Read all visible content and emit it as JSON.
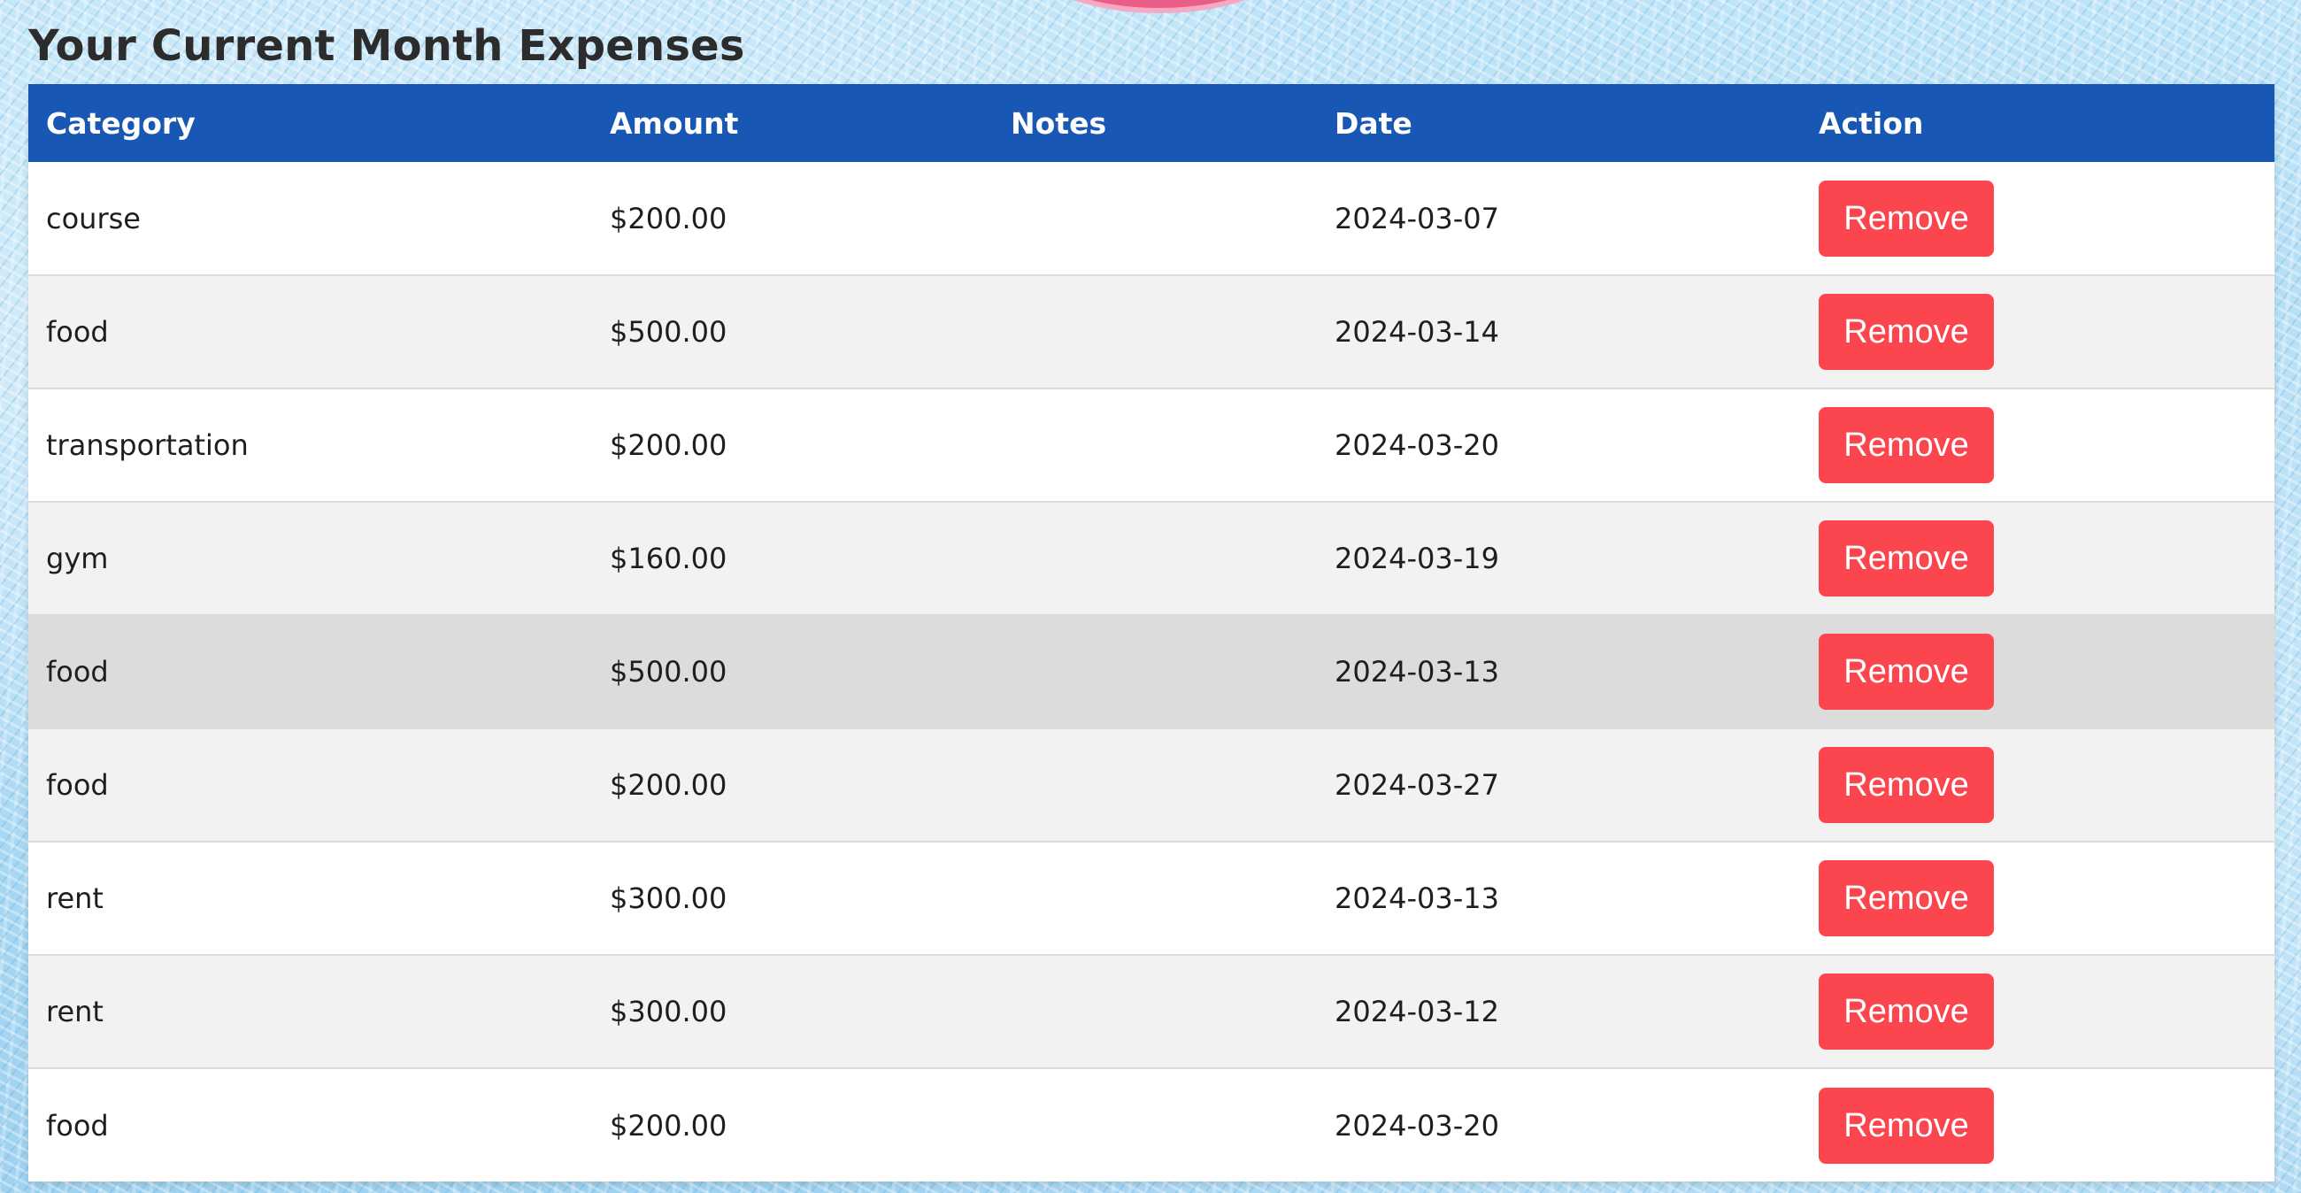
{
  "page": {
    "title": "Your Current Month Expenses"
  },
  "table": {
    "headers": {
      "category": "Category",
      "amount": "Amount",
      "notes": "Notes",
      "date": "Date",
      "action": "Action"
    },
    "rows": [
      {
        "category": "course",
        "amount": "$200.00",
        "notes": "",
        "date": "2024-03-07",
        "action": "Remove"
      },
      {
        "category": "food",
        "amount": "$500.00",
        "notes": "",
        "date": "2024-03-14",
        "action": "Remove"
      },
      {
        "category": "transportation",
        "amount": "$200.00",
        "notes": "",
        "date": "2024-03-20",
        "action": "Remove"
      },
      {
        "category": "gym",
        "amount": "$160.00",
        "notes": "",
        "date": "2024-03-19",
        "action": "Remove"
      },
      {
        "category": "food",
        "amount": "$500.00",
        "notes": "",
        "date": "2024-03-13",
        "action": "Remove"
      },
      {
        "category": "food",
        "amount": "$200.00",
        "notes": "",
        "date": "2024-03-27",
        "action": "Remove"
      },
      {
        "category": "rent",
        "amount": "$300.00",
        "notes": "",
        "date": "2024-03-13",
        "action": "Remove"
      },
      {
        "category": "rent",
        "amount": "$300.00",
        "notes": "",
        "date": "2024-03-12",
        "action": "Remove"
      },
      {
        "category": "food",
        "amount": "$200.00",
        "notes": "",
        "date": "2024-03-20",
        "action": "Remove"
      }
    ]
  },
  "colors": {
    "header_bg": "#1857b3",
    "remove_button": "#fb4650",
    "hovered_row": "#dcdcdc",
    "decor_blob": "#ea5d87"
  }
}
